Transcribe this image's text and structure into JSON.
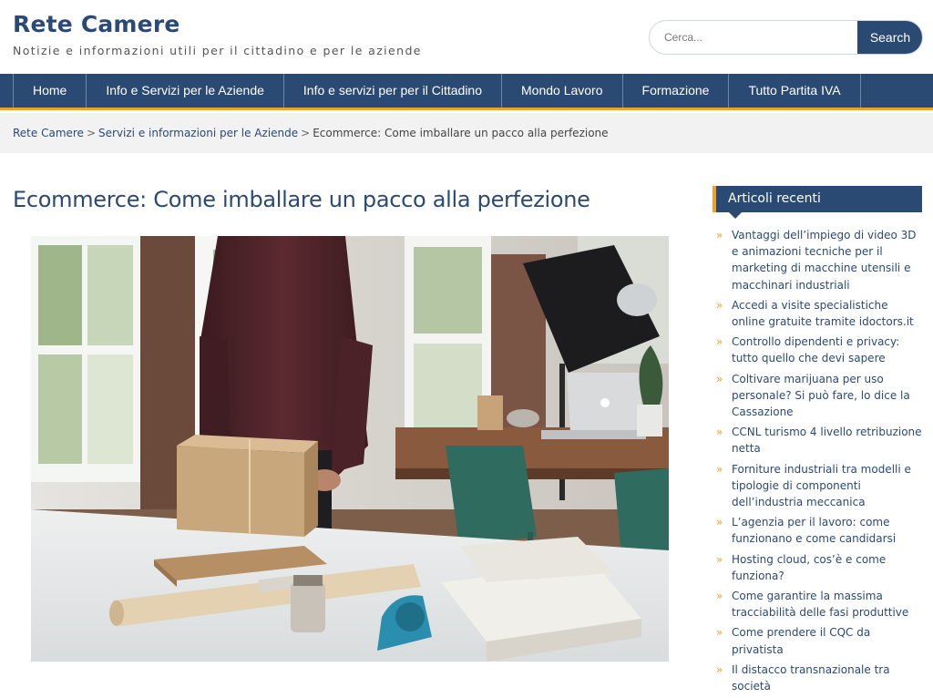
{
  "site": {
    "title": "Rete Camere",
    "tagline": "Notizie e informazioni utili per il cittadino e per le aziende"
  },
  "search": {
    "placeholder": "Cerca...",
    "button_label": "Search"
  },
  "nav": {
    "items": [
      {
        "label": "Home"
      },
      {
        "label": "Info e Servizi per le Aziende"
      },
      {
        "label": "Info e servizi per per il Cittadino"
      },
      {
        "label": "Mondo Lavoro"
      },
      {
        "label": "Formazione"
      },
      {
        "label": "Tutto Partita IVA"
      }
    ]
  },
  "breadcrumb": {
    "items": [
      {
        "label": "Rete Camere"
      },
      {
        "label": "Servizi e informazioni per le Aziende"
      },
      {
        "label": "Ecommerce: Come imballare un pacco alla perfezione"
      }
    ],
    "separator": ">"
  },
  "post": {
    "title": "Ecommerce: Come imballare un pacco alla perfezione"
  },
  "sidebar": {
    "title": "Articoli recenti",
    "bullet": "»",
    "items": [
      {
        "label": "Vantaggi dell’impiego di video 3D e animazioni tecniche per il marketing di macchine utensili e macchinari industriali"
      },
      {
        "label": "Accedi a visite specialistiche online gratuite tramite idoctors.it"
      },
      {
        "label": "Controllo dipendenti e privacy: tutto quello che devi sapere"
      },
      {
        "label": "Coltivare marijuana per uso personale? Si può fare, lo dice la Cassazione"
      },
      {
        "label": "CCNL turismo 4 livello retribuzione netta"
      },
      {
        "label": "Forniture industriali tra modelli e tipologie di componenti dell’industria meccanica"
      },
      {
        "label": "L’agenzia per il lavoro: come funzionano e come candidarsi"
      },
      {
        "label": "Hosting cloud, cos’è e come funziona?"
      },
      {
        "label": "Come garantire la massima tracciabilità delle fasi produttive"
      },
      {
        "label": "Come prendere il CQC da privatista"
      },
      {
        "label": "Il distacco transnazionale tra società"
      }
    ]
  },
  "colors": {
    "brand": "#2b4a73",
    "accent": "#f0a030"
  }
}
